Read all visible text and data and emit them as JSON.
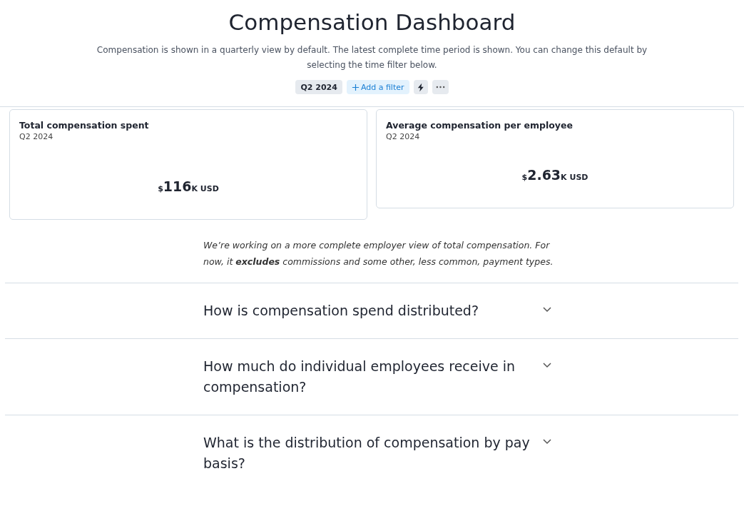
{
  "title": "Compensation Dashboard",
  "description": "Compensation is shown in a quarterly view by default. The latest complete time period is shown. You can change this default by selecting the time filter below.",
  "filters": [
    {
      "kind": "chip",
      "label": "Q2 2024"
    },
    {
      "kind": "add",
      "label": "Add a filter"
    },
    {
      "kind": "bolt"
    },
    {
      "kind": "more"
    }
  ],
  "metrics": [
    {
      "title": "Total compensation spent",
      "period": "Q2 2024",
      "prefix": "$",
      "value": "116",
      "suffix": "K USD"
    },
    {
      "title": "Average compensation per employee",
      "period": "Q2 2024",
      "prefix": "$",
      "value": "2.63",
      "suffix": "K USD"
    }
  ],
  "note": "We’re working on a more complete employer view of total compensation. For now, it **excludes** commissions and some other, less common, payment types.",
  "sections": [
    {
      "question": "How is compensation spend distributed?",
      "expanded": false
    },
    {
      "question": "How much do individual employees receive in compensation?",
      "expanded": false
    },
    {
      "question": "What is the distribution of compensation by pay basis?",
      "expanded": false
    }
  ]
}
